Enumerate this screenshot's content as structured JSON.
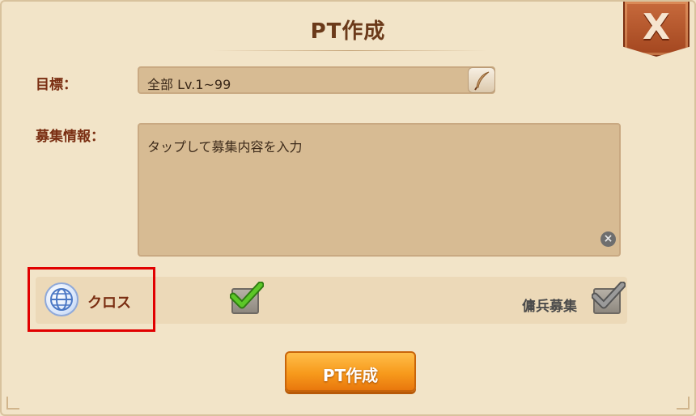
{
  "dialog": {
    "title": "PT作成",
    "close_label": "X"
  },
  "form": {
    "target_label": "目標：",
    "target_value": "全部 Lv.1~99",
    "info_label": "募集情報：",
    "info_placeholder": "タップして募集内容を入力",
    "clear_symbol": "×"
  },
  "options": {
    "cross_label": "クロス",
    "cross_checked": true,
    "mercenary_label": "傭兵募集",
    "mercenary_checked": true
  },
  "actions": {
    "create_label": "PT作成"
  },
  "colors": {
    "accent_orange": "#f79a1c",
    "highlight_red": "#e10000",
    "label_brown": "#7a2e12",
    "check_green": "#4fb51f"
  }
}
